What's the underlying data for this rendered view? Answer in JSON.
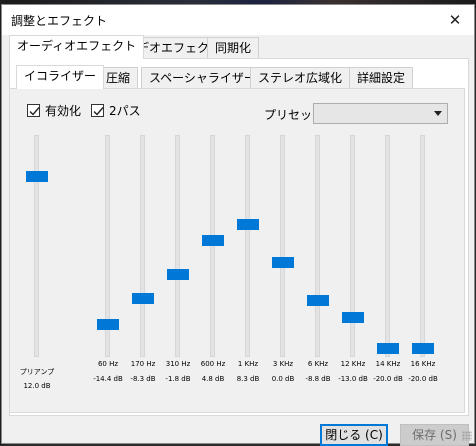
{
  "window": {
    "title": "調整とエフェクト",
    "close_glyph": "✕"
  },
  "main_tabs": [
    {
      "label": "オーディオエフェクト",
      "active": true
    },
    {
      "label": "ビデオエフェクト",
      "active": false
    },
    {
      "label": "同期化",
      "active": false
    }
  ],
  "sub_tabs": [
    {
      "label": "イコライザー",
      "active": true
    },
    {
      "label": "圧縮",
      "active": false
    },
    {
      "label": "スペーシャライザー",
      "active": false
    },
    {
      "label": "ステレオ広域化",
      "active": false
    },
    {
      "label": "詳細設定",
      "active": false
    }
  ],
  "equalizer": {
    "enable_label": "有効化",
    "enable_checked": true,
    "twopass_label": "2パス",
    "twopass_checked": true,
    "preset_label": "プリセット",
    "preset_value": "",
    "preamp": {
      "label": "プリアンプ",
      "gain": "12.0 dB",
      "level": 1.0
    },
    "bands": [
      {
        "freq": "60 Hz",
        "gain": "-14.4 dB",
        "level": 0.14
      },
      {
        "freq": "170 Hz",
        "gain": "-8.3 dB",
        "level": 0.29
      },
      {
        "freq": "310 Hz",
        "gain": "-1.8 dB",
        "level": 0.43
      },
      {
        "freq": "600 Hz",
        "gain": "4.8 dB",
        "level": 0.63
      },
      {
        "freq": "1 KHz",
        "gain": "8.3 dB",
        "level": 0.72
      },
      {
        "freq": "3 KHz",
        "gain": "0.0 dB",
        "level": 0.5
      },
      {
        "freq": "6 KHz",
        "gain": "-8.8 dB",
        "level": 0.28
      },
      {
        "freq": "12 KHz",
        "gain": "-13.0 dB",
        "level": 0.18
      },
      {
        "freq": "14 KHz",
        "gain": "-20.0 dB",
        "level": 0.0
      },
      {
        "freq": "16 KHz",
        "gain": "-20.0 dB",
        "level": 0.0
      }
    ]
  },
  "buttons": {
    "close_label": "閉じる (C)",
    "save_label": "保存 (S)"
  },
  "colors": {
    "accent": "#0078d7"
  }
}
